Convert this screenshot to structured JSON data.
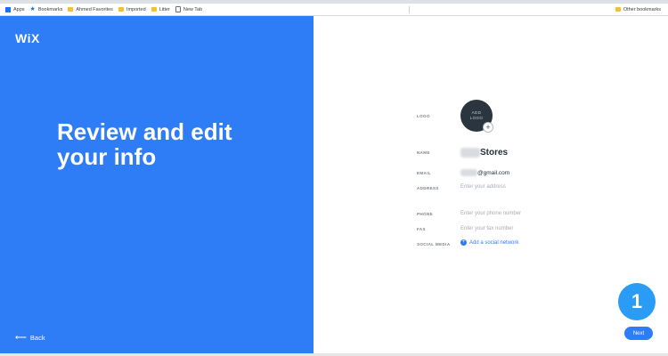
{
  "bookmarks": {
    "items": [
      {
        "label": "Apps",
        "icon": "apps-icon"
      },
      {
        "label": "Bookmarks",
        "icon": "star-icon"
      },
      {
        "label": "Ahmed Favorites",
        "icon": "folder-icon"
      },
      {
        "label": "Imported",
        "icon": "folder-icon"
      },
      {
        "label": "Litter",
        "icon": "folder-icon"
      },
      {
        "label": "New Tab",
        "icon": "page-icon"
      }
    ],
    "other": "Other bookmarks"
  },
  "left": {
    "logo": "WiX",
    "headline_line1": "Review and edit",
    "headline_line2": "your info",
    "back_label": "Back"
  },
  "form": {
    "logo_label": "LOGO",
    "logo_button": "ADD LOGO",
    "name_label": "NAME",
    "name_value": "Stores",
    "email_label": "EMAIL",
    "email_value": "@gmail.com",
    "address_label": "ADDRESS",
    "address_placeholder": "Enter your address",
    "phone_label": "PHONE",
    "phone_placeholder": "Enter your phone number",
    "fax_label": "FAX",
    "fax_placeholder": "Enter your fax number",
    "social_label": "SOCIAL MEDIA",
    "social_link": "Add a social network"
  },
  "step_badge": "1",
  "next_label": "Next",
  "colors": {
    "primary": "#2e7cf6",
    "badge": "#2a9cf5",
    "logo_bg": "#2b3540"
  }
}
